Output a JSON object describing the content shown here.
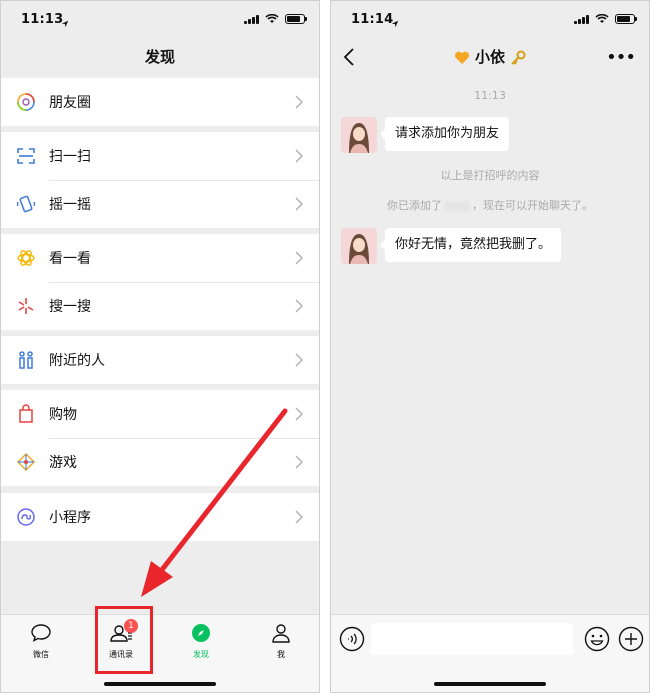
{
  "left_screen": {
    "status_time": "11:13",
    "title": "发现",
    "menu_groups": [
      [
        {
          "label": "朋友圈",
          "icon": "moments-icon"
        }
      ],
      [
        {
          "label": "扫一扫",
          "icon": "scan-icon"
        },
        {
          "label": "摇一摇",
          "icon": "shake-icon"
        }
      ],
      [
        {
          "label": "看一看",
          "icon": "top-stories-icon"
        },
        {
          "label": "搜一搜",
          "icon": "search-icon"
        }
      ],
      [
        {
          "label": "附近的人",
          "icon": "people-nearby-icon"
        }
      ],
      [
        {
          "label": "购物",
          "icon": "shopping-bag-icon"
        },
        {
          "label": "游戏",
          "icon": "games-icon"
        }
      ],
      [
        {
          "label": "小程序",
          "icon": "mini-programs-icon"
        }
      ]
    ],
    "tabs": [
      {
        "label": "微信",
        "icon": "chat-bubble-icon"
      },
      {
        "label": "通讯录",
        "icon": "contacts-icon",
        "badge": "1"
      },
      {
        "label": "发现",
        "icon": "discover-compass-icon"
      },
      {
        "label": "我",
        "icon": "me-person-icon"
      }
    ],
    "highlight_color": "#e8262b",
    "active_color": "#07c160"
  },
  "right_screen": {
    "status_time": "11:14",
    "chat_title": "小依",
    "timestamp": "11:13",
    "messages": [
      {
        "text": "请求添加你为朋友"
      },
      {
        "text": "你好无情，竟然把我删了。"
      }
    ],
    "note_greeting": "以上是打招呼的内容",
    "note_added_prefix": "你已添加了",
    "note_added_suffix": "，现在可以开始聊天了。",
    "input_placeholder": ""
  }
}
